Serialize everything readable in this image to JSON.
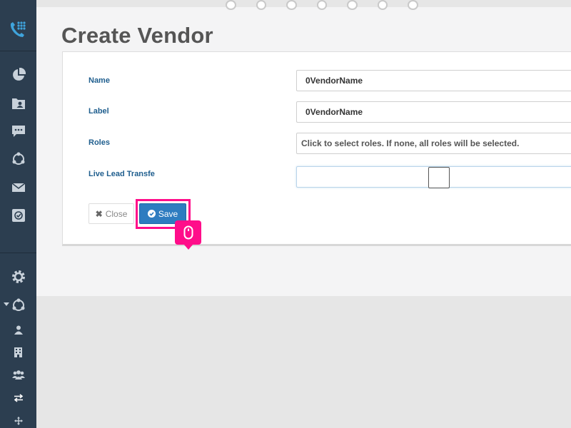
{
  "page": {
    "title": "Create Vendor"
  },
  "form": {
    "name_label": "Name",
    "name_value": "0VendorName",
    "label_label": "Label",
    "label_value": "0VendorName",
    "roles_label": "Roles",
    "roles_placeholder": "Click to select roles. If none, all roles will be selected.",
    "live_lead_label": "Live Lead Transfe"
  },
  "actions": {
    "close_label": "Close",
    "save_label": "Save"
  },
  "icons": {
    "sidebar": [
      "phone-dialpad-icon",
      "pie-chart-icon",
      "contact-folder-icon",
      "chat-icon",
      "share-nodes-icon",
      "envelope-icon",
      "check-square-icon",
      "gear-icon",
      "share-nodes-icon",
      "user-icon",
      "building-icon",
      "users-icon",
      "transfer-arrows-icon",
      "move-arrows-icon"
    ],
    "tooltip": "mouse-icon"
  },
  "colors": {
    "sidebar_bg": "#2c3e50",
    "accent_blue": "#2e7cc0",
    "label_blue": "#1f5e8e",
    "highlight_pink": "#ff0d8a"
  }
}
